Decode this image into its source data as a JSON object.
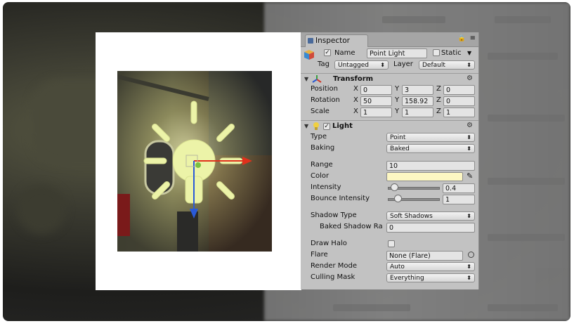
{
  "inspector": {
    "tab_label": "Inspector",
    "name_label": "Name",
    "object_name": "Point Light",
    "static_label": "Static",
    "tag_label": "Tag",
    "tag_value": "Untagged",
    "layer_label": "Layer",
    "layer_value": "Default"
  },
  "transform": {
    "title": "Transform",
    "position_label": "Position",
    "rotation_label": "Rotation",
    "scale_label": "Scale",
    "x": "X",
    "y": "Y",
    "z": "Z",
    "position": [
      "0",
      "3",
      "0"
    ],
    "rotation": [
      "50",
      "158.92",
      "0"
    ],
    "scale": [
      "1",
      "1",
      "1"
    ]
  },
  "light": {
    "title": "Light",
    "type_label": "Type",
    "type_value": "Point",
    "baking_label": "Baking",
    "baking_value": "Baked",
    "range_label": "Range",
    "range_value": "10",
    "color_label": "Color",
    "color_value": "#fdf7c3",
    "intensity_label": "Intensity",
    "intensity_value": "0.4",
    "intensity_fraction": 0.05,
    "bounce_label": "Bounce Intensity",
    "bounce_value": "1",
    "bounce_fraction": 0.12,
    "shadow_type_label": "Shadow Type",
    "shadow_type_value": "Soft Shadows",
    "baked_shadow_label": "Baked Shadow Ra",
    "baked_shadow_value": "0",
    "draw_halo_label": "Draw Halo",
    "flare_label": "Flare",
    "flare_value": "None (Flare)",
    "render_mode_label": "Render Mode",
    "render_mode_value": "Auto",
    "culling_mask_label": "Culling Mask",
    "culling_mask_value": "Everything"
  },
  "icons": {
    "dropdown_arrow": "⬍",
    "gear": "⚙",
    "triangle": "▼",
    "lock": "🔒"
  }
}
